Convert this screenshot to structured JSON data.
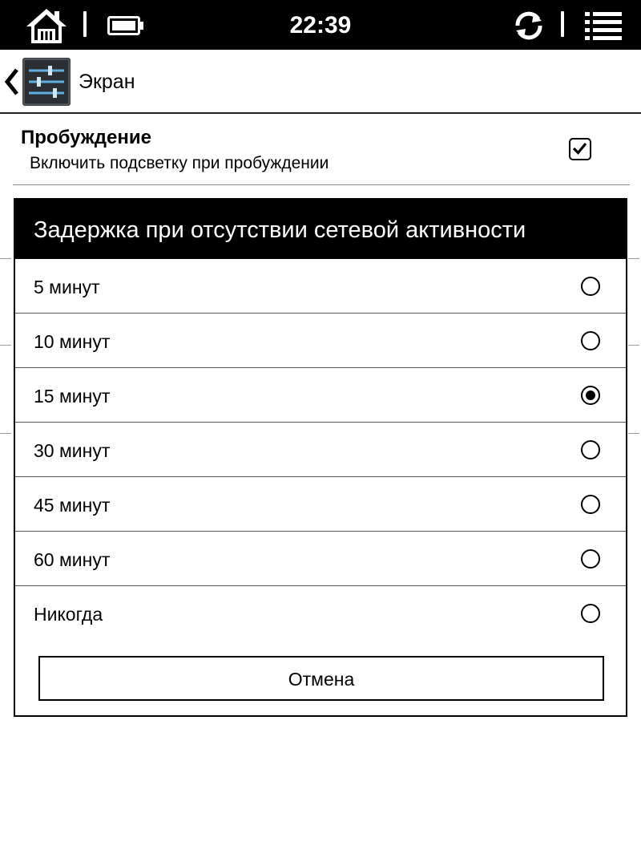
{
  "status_bar": {
    "time": "22:39",
    "icons": [
      "home-icon",
      "battery-icon",
      "sync-icon",
      "menu-icon"
    ]
  },
  "header": {
    "title": "Экран",
    "icons": [
      "back-chevron-icon",
      "settings-sliders-icon"
    ]
  },
  "setting": {
    "title": "Пробуждение",
    "subtitle": "Включить подсветку при пробуждении",
    "checked": true
  },
  "dialog": {
    "title": "Задержка при отсутствии сетевой активности",
    "options": [
      {
        "label": "5 минут",
        "selected": false
      },
      {
        "label": "10 минут",
        "selected": false
      },
      {
        "label": "15 минут",
        "selected": true
      },
      {
        "label": "30 минут",
        "selected": false
      },
      {
        "label": "45 минут",
        "selected": false
      },
      {
        "label": "60 минут",
        "selected": false
      },
      {
        "label": "Никогда",
        "selected": false
      }
    ],
    "cancel_label": "Отмена"
  }
}
